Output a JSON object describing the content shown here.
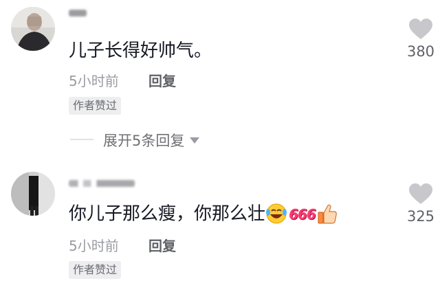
{
  "comments": [
    {
      "text": "儿子长得好帅气。",
      "time": "5小时前",
      "reply_label": "回复",
      "badge": "作者赞过",
      "likes": "380"
    },
    {
      "text": "你儿子那么瘦，你那么壮",
      "emoji_666": "666",
      "time": "5小时前",
      "reply_label": "回复",
      "badge": "作者赞过",
      "likes": "325"
    }
  ],
  "expand_replies": "展开5条回复",
  "colors": {
    "text": "#161823",
    "muted": "#9a9ca3",
    "badge_bg": "#eeeef0",
    "heart": "#c8c8cc"
  }
}
